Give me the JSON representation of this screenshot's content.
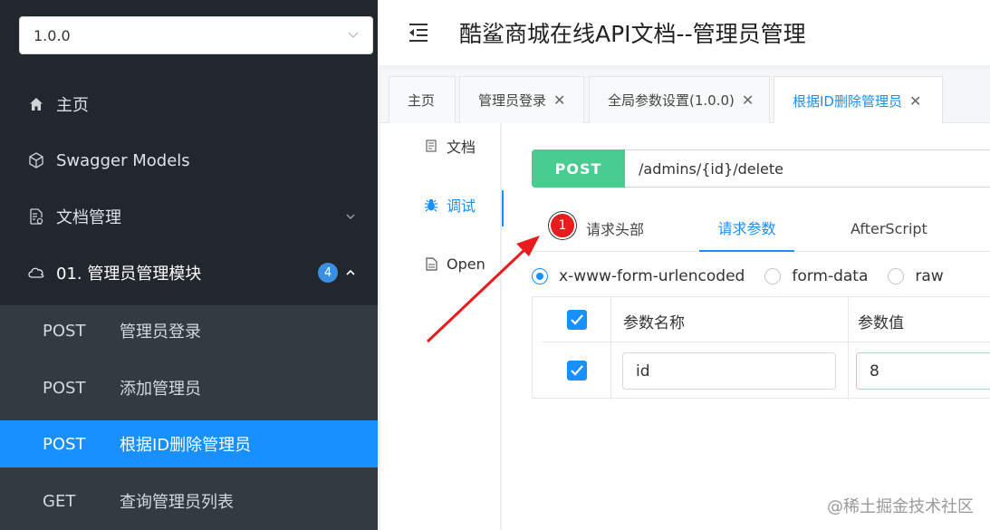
{
  "sidebar": {
    "version": "1.0.0",
    "items": [
      {
        "label": "主页",
        "icon": "home-icon"
      },
      {
        "label": "Swagger Models",
        "icon": "cube-icon"
      },
      {
        "label": "文档管理",
        "icon": "doc-settings-icon"
      },
      {
        "label": "01. 管理员管理模块",
        "icon": "cloud-icon",
        "badge": "4"
      }
    ],
    "sub_items": [
      {
        "method": "POST",
        "label": "管理员登录"
      },
      {
        "method": "POST",
        "label": "添加管理员"
      },
      {
        "method": "POST",
        "label": "根据ID删除管理员",
        "active": true
      },
      {
        "method": "GET",
        "label": "查询管理员列表"
      }
    ]
  },
  "header": {
    "title": "酷鲨商城在线API文档--管理员管理"
  },
  "tabs": [
    {
      "label": "主页",
      "closable": false
    },
    {
      "label": "管理员登录",
      "closable": true
    },
    {
      "label": "全局参数设置(1.0.0)",
      "closable": true
    },
    {
      "label": "根据ID删除管理员",
      "closable": true,
      "active": true
    }
  ],
  "left_menu": [
    {
      "label": "文档",
      "icon": "document-icon"
    },
    {
      "label": "调试",
      "icon": "bug-icon",
      "active": true
    },
    {
      "label": "Open",
      "icon": "file-icon"
    }
  ],
  "request": {
    "method": "POST",
    "url": "/admins/{id}/delete"
  },
  "subtabs": [
    {
      "label": "请求头部",
      "badge": "1"
    },
    {
      "label": "请求参数",
      "active": true
    },
    {
      "label": "AfterScript"
    }
  ],
  "body_types": [
    {
      "label": "x-www-form-urlencoded",
      "checked": true
    },
    {
      "label": "form-data",
      "checked": false
    },
    {
      "label": "raw",
      "checked": false
    }
  ],
  "params_table": {
    "headers": [
      "参数名称",
      "参数值"
    ],
    "rows": [
      {
        "checked": true,
        "name": "id",
        "value": "8"
      }
    ]
  },
  "watermark": "@稀土掘金技术社区",
  "colors": {
    "sidebar_bg": "#22272e",
    "active_blue": "#1890ff",
    "post_green": "#49cc90",
    "annotation_red": "#e81c1c"
  }
}
